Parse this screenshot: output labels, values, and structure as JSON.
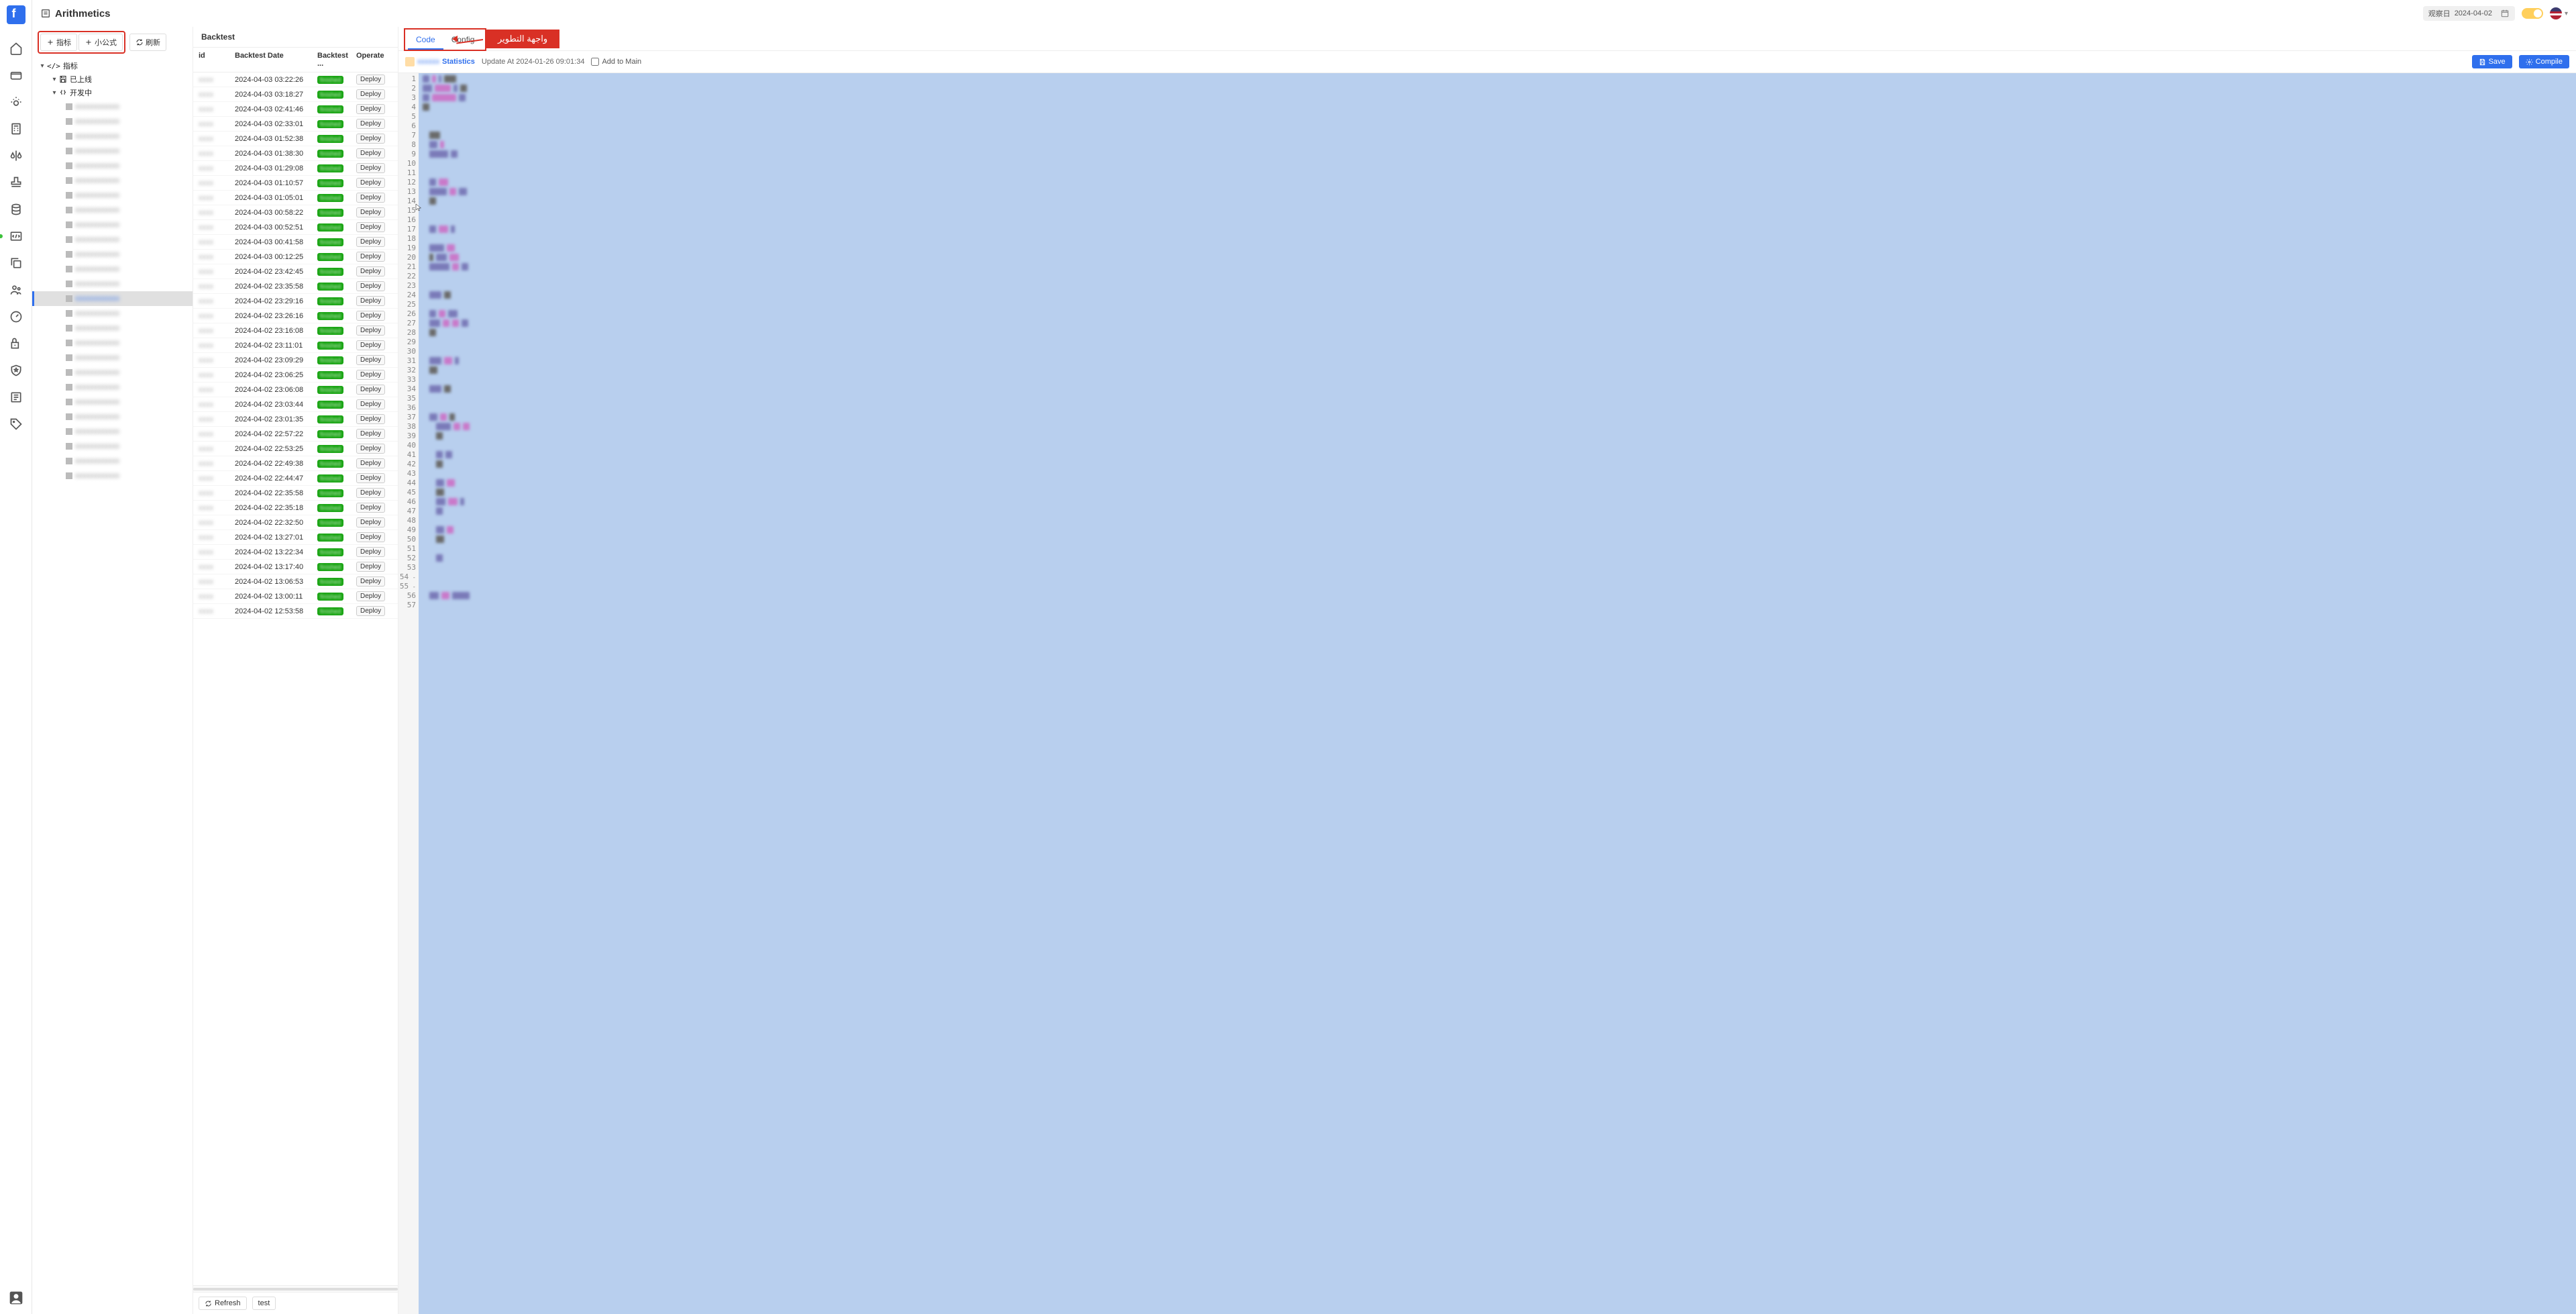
{
  "header": {
    "title": "Arithmetics",
    "observation_label": "观察日",
    "observation_date": "2024-04-02"
  },
  "annotation": {
    "text": "واجهة التطوير"
  },
  "tree": {
    "buttons": {
      "metric": "指标",
      "formula": "小公式",
      "refresh": "刷新"
    },
    "root_label": "指标",
    "group_online": "已上线",
    "group_dev": "开发中",
    "items_dev_count": 26
  },
  "backtest": {
    "title": "Backtest",
    "columns": {
      "id": "id",
      "date": "Backtest Date",
      "status": "Backtest ...",
      "operate": "Operate"
    },
    "status_text": "finished",
    "deploy_label": "Deploy",
    "rows": [
      {
        "id": "—",
        "date": "2024-04-03 03:22:26"
      },
      {
        "id": "—",
        "date": "2024-04-03 03:18:27"
      },
      {
        "id": "—",
        "date": "2024-04-03 02:41:46"
      },
      {
        "id": "—",
        "date": "2024-04-03 02:33:01"
      },
      {
        "id": "—",
        "date": "2024-04-03 01:52:38"
      },
      {
        "id": "—",
        "date": "2024-04-03 01:38:30"
      },
      {
        "id": "—",
        "date": "2024-04-03 01:29:08"
      },
      {
        "id": "—",
        "date": "2024-04-03 01:10:57"
      },
      {
        "id": "—",
        "date": "2024-04-03 01:05:01"
      },
      {
        "id": "—",
        "date": "2024-04-03 00:58:22"
      },
      {
        "id": "—",
        "date": "2024-04-03 00:52:51"
      },
      {
        "id": "—",
        "date": "2024-04-03 00:41:58"
      },
      {
        "id": "—",
        "date": "2024-04-03 00:12:25"
      },
      {
        "id": "—",
        "date": "2024-04-02 23:42:45"
      },
      {
        "id": "—",
        "date": "2024-04-02 23:35:58"
      },
      {
        "id": "—",
        "date": "2024-04-02 23:29:16"
      },
      {
        "id": "—",
        "date": "2024-04-02 23:26:16"
      },
      {
        "id": "—",
        "date": "2024-04-02 23:16:08"
      },
      {
        "id": "—",
        "date": "2024-04-02 23:11:01"
      },
      {
        "id": "—",
        "date": "2024-04-02 23:09:29"
      },
      {
        "id": "—",
        "date": "2024-04-02 23:06:25"
      },
      {
        "id": "—",
        "date": "2024-04-02 23:06:08"
      },
      {
        "id": "—",
        "date": "2024-04-02 23:03:44"
      },
      {
        "id": "—",
        "date": "2024-04-02 23:01:35"
      },
      {
        "id": "—",
        "date": "2024-04-02 22:57:22"
      },
      {
        "id": "—",
        "date": "2024-04-02 22:53:25"
      },
      {
        "id": "—",
        "date": "2024-04-02 22:49:38"
      },
      {
        "id": "—",
        "date": "2024-04-02 22:44:47"
      },
      {
        "id": "—",
        "date": "2024-04-02 22:35:58"
      },
      {
        "id": "—",
        "date": "2024-04-02 22:35:18"
      },
      {
        "id": "—",
        "date": "2024-04-02 22:32:50"
      },
      {
        "id": "—",
        "date": "2024-04-02 13:27:01"
      },
      {
        "id": "—",
        "date": "2024-04-02 13:22:34"
      },
      {
        "id": "—",
        "date": "2024-04-02 13:17:40"
      },
      {
        "id": "—",
        "date": "2024-04-02 13:06:53"
      },
      {
        "id": "—",
        "date": "2024-04-02 13:00:11"
      },
      {
        "id": "—",
        "date": "2024-04-02 12:53:58"
      }
    ],
    "footer": {
      "refresh": "Refresh",
      "test": "test"
    }
  },
  "editor": {
    "tabs": {
      "code": "Code",
      "config": "Config"
    },
    "kind_suffix": "Statistics",
    "update_text": "Update At 2024-01-26 09:01:34",
    "add_main": "Add to Main",
    "save": "Save",
    "compile": "Compile",
    "line_count": 57,
    "fold_lines": [
      54,
      55
    ],
    "code_tokens": [
      [
        [
          0,
          10,
          "a"
        ],
        [
          0,
          6,
          "b"
        ],
        [
          0,
          4,
          "a"
        ],
        [
          0,
          18,
          "c"
        ]
      ],
      [
        [
          0,
          14,
          "a"
        ],
        [
          0,
          24,
          "b"
        ],
        [
          0,
          6,
          "a"
        ],
        [
          0,
          10,
          "c"
        ]
      ],
      [
        [
          0,
          10,
          "a"
        ],
        [
          0,
          36,
          "b"
        ],
        [
          0,
          10,
          "a"
        ]
      ],
      [
        [
          0,
          10,
          "c"
        ]
      ],
      [
        [
          0,
          0
        ]
      ],
      [
        [
          0,
          0
        ]
      ],
      [
        [
          10,
          16,
          "c"
        ]
      ],
      [
        [
          10,
          12,
          "a"
        ],
        [
          0,
          6,
          "b"
        ]
      ],
      [
        [
          10,
          28,
          "a"
        ],
        [
          0,
          10,
          "a"
        ]
      ],
      [
        [
          0,
          0
        ]
      ],
      [
        [
          0,
          0
        ]
      ],
      [
        [
          10,
          10,
          "a"
        ],
        [
          0,
          14,
          "b"
        ]
      ],
      [
        [
          10,
          26,
          "a"
        ],
        [
          0,
          10,
          "b"
        ],
        [
          0,
          12,
          "a"
        ]
      ],
      [
        [
          10,
          10,
          "c"
        ]
      ],
      [
        [
          0,
          0
        ]
      ],
      [
        [
          0,
          0
        ]
      ],
      [
        [
          10,
          10,
          "a"
        ],
        [
          0,
          14,
          "b"
        ],
        [
          0,
          6,
          "a"
        ]
      ],
      [
        [
          0,
          0
        ]
      ],
      [
        [
          10,
          22,
          "a"
        ],
        [
          0,
          12,
          "b"
        ]
      ],
      [
        [
          10,
          6,
          "c"
        ],
        [
          0,
          16,
          "a"
        ],
        [
          0,
          14,
          "b"
        ]
      ],
      [
        [
          10,
          30,
          "a"
        ],
        [
          0,
          10,
          "b"
        ],
        [
          0,
          10,
          "a"
        ]
      ],
      [
        [
          0,
          0
        ]
      ],
      [
        [
          0,
          0
        ]
      ],
      [
        [
          10,
          18,
          "a"
        ],
        [
          0,
          10,
          "c"
        ]
      ],
      [
        [
          0,
          0
        ]
      ],
      [
        [
          10,
          10,
          "a"
        ],
        [
          0,
          10,
          "b"
        ],
        [
          0,
          14,
          "a"
        ]
      ],
      [
        [
          10,
          16,
          "a"
        ],
        [
          0,
          10,
          "b"
        ],
        [
          0,
          10,
          "b"
        ],
        [
          0,
          10,
          "a"
        ]
      ],
      [
        [
          10,
          10,
          "c"
        ]
      ],
      [
        [
          0,
          0
        ]
      ],
      [
        [
          0,
          0
        ]
      ],
      [
        [
          10,
          18,
          "a"
        ],
        [
          0,
          12,
          "b"
        ],
        [
          0,
          6,
          "a"
        ]
      ],
      [
        [
          10,
          12,
          "c"
        ]
      ],
      [
        [
          0,
          0
        ]
      ],
      [
        [
          10,
          18,
          "a"
        ],
        [
          0,
          10,
          "c"
        ]
      ],
      [
        [
          0,
          0
        ]
      ],
      [
        [
          0,
          0
        ]
      ],
      [
        [
          10,
          12,
          "a"
        ],
        [
          0,
          10,
          "b"
        ],
        [
          0,
          8,
          "c"
        ]
      ],
      [
        [
          20,
          22,
          "a"
        ],
        [
          0,
          10,
          "b"
        ],
        [
          0,
          10,
          "b"
        ]
      ],
      [
        [
          20,
          10,
          "c"
        ]
      ],
      [
        [
          0,
          0
        ]
      ],
      [
        [
          20,
          10,
          "a"
        ],
        [
          0,
          10,
          "a"
        ]
      ],
      [
        [
          20,
          10,
          "c"
        ]
      ],
      [
        [
          0,
          0
        ]
      ],
      [
        [
          20,
          12,
          "a"
        ],
        [
          0,
          12,
          "b"
        ]
      ],
      [
        [
          20,
          12,
          "c"
        ]
      ],
      [
        [
          20,
          14,
          "a"
        ],
        [
          0,
          14,
          "b"
        ],
        [
          0,
          6,
          "a"
        ]
      ],
      [
        [
          20,
          10,
          "a"
        ]
      ],
      [
        [
          0,
          0
        ]
      ],
      [
        [
          20,
          12,
          "a"
        ],
        [
          0,
          10,
          "b"
        ]
      ],
      [
        [
          20,
          12,
          "c"
        ]
      ],
      [
        [
          0,
          0
        ]
      ],
      [
        [
          20,
          10,
          "a"
        ]
      ],
      [
        [
          0,
          0
        ]
      ],
      [
        [
          0,
          0
        ]
      ],
      [
        [
          0,
          0
        ]
      ],
      [
        [
          10,
          14,
          "a"
        ],
        [
          0,
          12,
          "b"
        ],
        [
          0,
          26,
          "a"
        ]
      ],
      [
        [
          0,
          0
        ]
      ]
    ]
  }
}
